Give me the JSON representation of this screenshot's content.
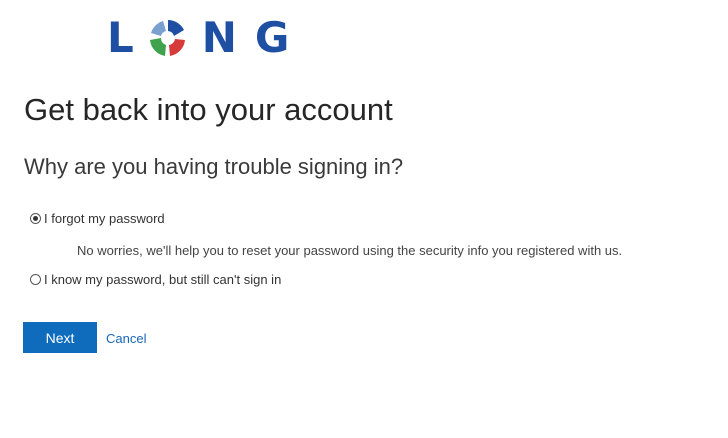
{
  "brand": {
    "letters": [
      "L",
      "N",
      "G"
    ],
    "colors": {
      "text": "#1f4fa3",
      "swirl_red": "#d63a3a",
      "swirl_green": "#3fa34d",
      "swirl_blue": "#1f4fa3"
    }
  },
  "page": {
    "title": "Get back into your account",
    "subtitle": "Why are you having trouble signing in?"
  },
  "options": [
    {
      "label": "I forgot my password",
      "selected": true
    },
    {
      "label": "I know my password, but still can't sign in",
      "selected": false
    }
  ],
  "hint": "No worries, we'll help you to reset your password using the security info you registered with us.",
  "actions": {
    "next_label": "Next",
    "cancel_label": "Cancel"
  },
  "colors": {
    "primary": "#0f6cbd",
    "link": "#1a66b8"
  }
}
